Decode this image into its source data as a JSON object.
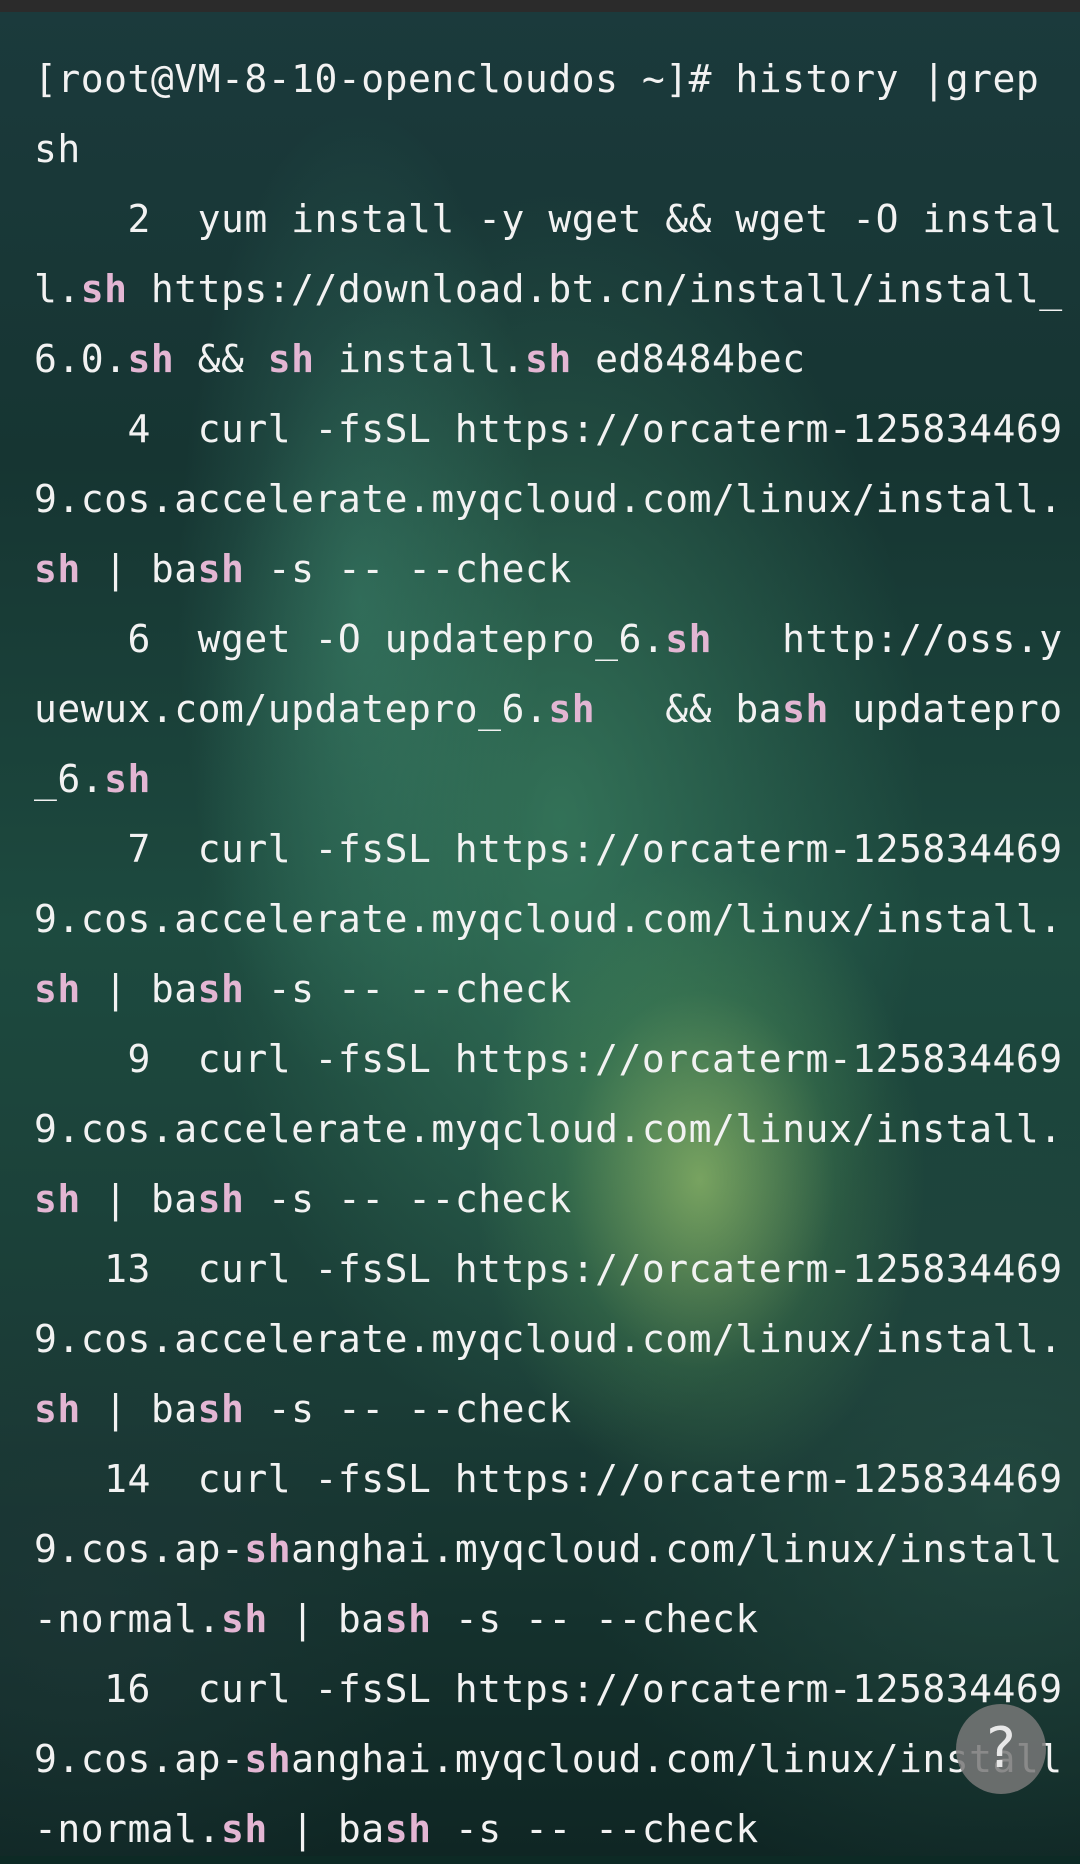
{
  "terminal": {
    "lines": [
      [
        "[root@VM-8-10-opencloudos ~]# history |grep"
      ],
      [
        "sh"
      ],
      [
        "    2  yum install -y wget && wget -O instal"
      ],
      [
        "l.",
        "*sh",
        " https://download.bt.cn/install/install_"
      ],
      [
        "6.0.",
        "*sh",
        " && ",
        "*sh",
        " install.",
        "*sh",
        " ed8484bec"
      ],
      [
        "    4  curl -fsSL https://orcaterm-125834469"
      ],
      [
        "9.cos.accelerate.myqcloud.com/linux/install."
      ],
      [
        "*sh",
        " | ba",
        "*sh",
        " -s -- --check"
      ],
      [
        "    6  wget -O updatepro_6.",
        "*sh",
        "   http://oss.y"
      ],
      [
        "uewux.com/updatepro_6.",
        "*sh",
        "   && ba",
        "*sh",
        " updatepro"
      ],
      [
        "_6.",
        "*sh"
      ],
      [
        "    7  curl -fsSL https://orcaterm-125834469"
      ],
      [
        "9.cos.accelerate.myqcloud.com/linux/install."
      ],
      [
        "*sh",
        " | ba",
        "*sh",
        " -s -- --check"
      ],
      [
        "    9  curl -fsSL https://orcaterm-125834469"
      ],
      [
        "9.cos.accelerate.myqcloud.com/linux/install."
      ],
      [
        "*sh",
        " | ba",
        "*sh",
        " -s -- --check"
      ],
      [
        "   13  curl -fsSL https://orcaterm-125834469"
      ],
      [
        "9.cos.accelerate.myqcloud.com/linux/install."
      ],
      [
        "*sh",
        " | ba",
        "*sh",
        " -s -- --check"
      ],
      [
        "   14  curl -fsSL https://orcaterm-125834469"
      ],
      [
        "9.cos.ap-",
        "*sh",
        "anghai.myqcloud.com/linux/install"
      ],
      [
        "-normal.",
        "*sh",
        " | ba",
        "*sh",
        " -s -- --check"
      ],
      [
        "   16  curl -fsSL https://orcaterm-125834469"
      ],
      [
        "9.cos.ap-",
        "*sh",
        "anghai.myqcloud.com/linux/install"
      ],
      [
        "-normal.",
        "*sh",
        " | ba",
        "*sh",
        " -s -- --check"
      ]
    ]
  },
  "help_button": {
    "label": "?"
  },
  "colors": {
    "text": "#f2f2f2",
    "match_highlight": "#e3b6d3",
    "help_button_bg": "#787878"
  }
}
